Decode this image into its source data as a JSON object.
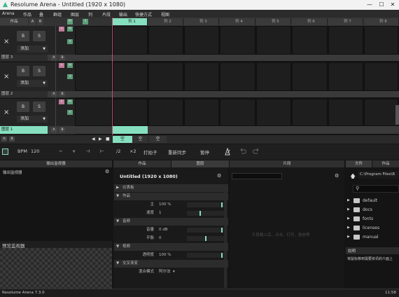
{
  "window": {
    "title": "Resolume Arena - Untitled (1920 x 1080)",
    "minimize": "—",
    "maximize": "☐",
    "close": "✕"
  },
  "menu": [
    "Arena",
    "作品",
    "叠",
    "群组",
    "图层",
    "列",
    "片段",
    "输出",
    "快捷方式",
    "视图"
  ],
  "deck": {
    "tab1": "作品",
    "tab2": "A",
    "tab3": "B",
    "m": "M",
    "s": "S"
  },
  "columns": [
    "列 1",
    "列 2",
    "列 3",
    "列 4",
    "列 5",
    "列 6",
    "列 7",
    "列 8"
  ],
  "layers": [
    {
      "name": "图层 3",
      "selected": false
    },
    {
      "name": "图层 2",
      "selected": false
    },
    {
      "name": "图层 1",
      "selected": true
    }
  ],
  "layer_controls": {
    "close": "×",
    "b": "B",
    "s": "S",
    "add": "添加",
    "a": "A",
    "m": "M",
    "v": "V"
  },
  "bottom_row": {
    "empty": "空",
    "prev": "◀",
    "next": "▶",
    "stop": "■",
    "a": "A",
    "b": "B"
  },
  "transport": {
    "bpm_label": "BPM",
    "bpm_value": "120",
    "minus": "−",
    "plus": "+",
    "nudge_left": "⊣",
    "nudge_right": "⊢",
    "div2": "/2",
    "mul2": "×2",
    "tap": "打拍子",
    "resync": "重新同步",
    "pause": "暂停"
  },
  "panels": {
    "output_monitor": "输出监视器",
    "composition": "作品",
    "layer": "图层",
    "clip": "片段",
    "files": "文件",
    "composition2": "作品",
    "preview_monitor": "预览监视器"
  },
  "composition_panel": {
    "title": "Untitled (1920 x 1080)",
    "sections": [
      {
        "name": "仪表板",
        "rows": []
      },
      {
        "name": "作品",
        "rows": [
          {
            "label": "主",
            "value": "100 %",
            "level": 0.95
          },
          {
            "label": "速度",
            "value": "1",
            "level": 0.35
          }
        ]
      },
      {
        "name": "音频",
        "rows": [
          {
            "label": "音量",
            "value": "0 dB",
            "level": 0.95
          },
          {
            "label": "平衡",
            "value": "0",
            "level": 0.5
          }
        ]
      },
      {
        "name": "视频",
        "rows": [
          {
            "label": "透明度",
            "value": "100 %",
            "level": 0.95
          }
        ]
      },
      {
        "name": "交叉渐变",
        "rows": [
          {
            "label": "混合模式",
            "value": "阿尔法",
            "level": null
          }
        ]
      }
    ]
  },
  "clip_panel": {
    "hint": "片段载入后，点击，打开，拖放等"
  },
  "files": {
    "path": "C:\\Program Files\\R",
    "search_placeholder": "",
    "items": [
      "default",
      "docs",
      "fonts",
      "licenses",
      "manual"
    ]
  },
  "description": {
    "title": "說明",
    "text": "将鼠标移到需要资讯的介面上"
  },
  "status": {
    "version": "Resolume Arena 7.3.0",
    "time": "11:58"
  },
  "colors": {
    "accent": "#86e0bf",
    "m_button": "#5b9d78",
    "a_button": "#bf7a98"
  }
}
